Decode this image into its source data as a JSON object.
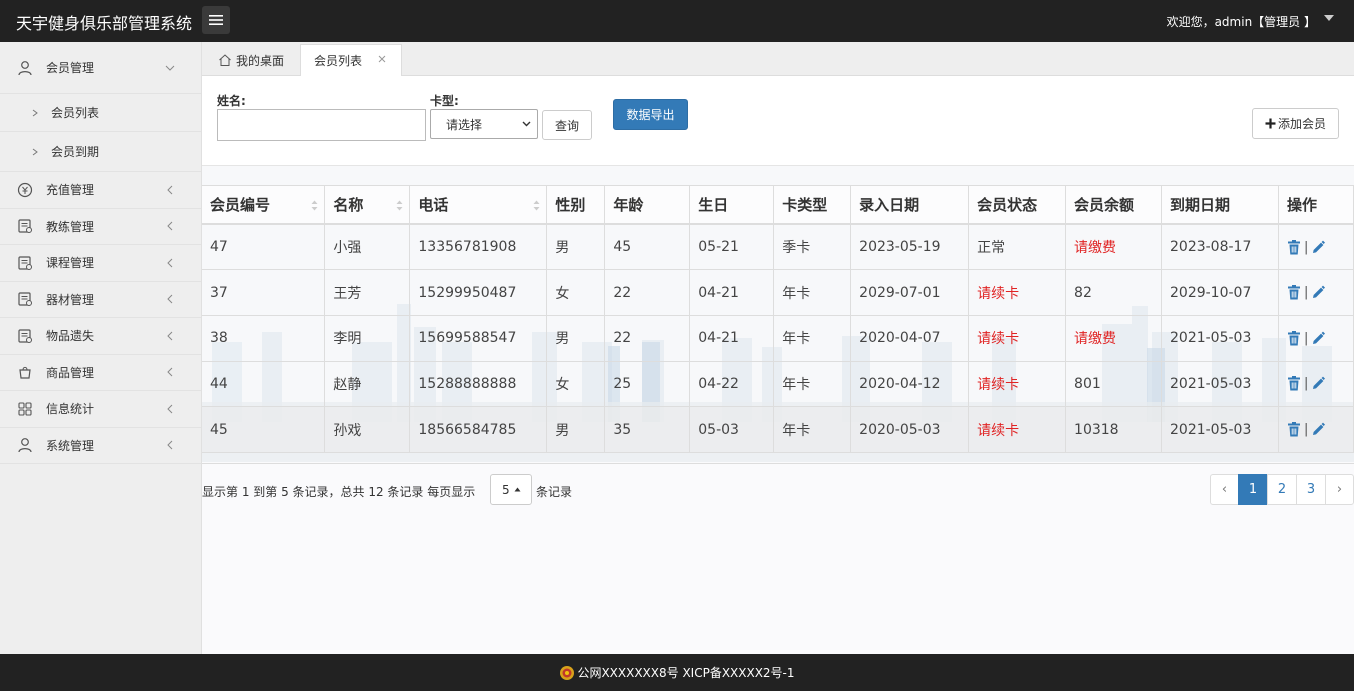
{
  "app": {
    "title": "天宇健身俱乐部管理系统",
    "welcome": "欢迎您，admin【管理员 】"
  },
  "sidebar": {
    "items": [
      {
        "label": "会员管理",
        "icon": "user-icon"
      },
      {
        "label": "充值管理",
        "icon": "money-icon"
      },
      {
        "label": "教练管理",
        "icon": "doc-icon"
      },
      {
        "label": "课程管理",
        "icon": "doc-icon"
      },
      {
        "label": "器材管理",
        "icon": "doc-icon"
      },
      {
        "label": "物品遗失",
        "icon": "doc-icon"
      },
      {
        "label": "商品管理",
        "icon": "bag-icon"
      },
      {
        "label": "信息统计",
        "icon": "grid-icon"
      },
      {
        "label": "系统管理",
        "icon": "user-icon"
      }
    ],
    "subitems": [
      {
        "label": "会员列表"
      },
      {
        "label": "会员到期"
      }
    ]
  },
  "tabs": [
    {
      "label": "我的桌面"
    },
    {
      "label": "会员列表"
    }
  ],
  "search": {
    "name_label": "姓名:",
    "name_value": "",
    "card_label": "卡型:",
    "card_selected": "请选择",
    "query_button": "查询",
    "export_button": "数据导出",
    "add_button": "添加会员"
  },
  "table": {
    "columns": [
      "会员编号",
      "名称",
      "电话",
      "性别",
      "年龄",
      "生日",
      "卡类型",
      "录入日期",
      "会员状态",
      "会员余额",
      "到期日期",
      "操作"
    ],
    "rows": [
      {
        "id": "47",
        "name": "小强",
        "phone": "13356781908",
        "gender": "男",
        "age": "45",
        "birthday": "05-21",
        "card": "季卡",
        "created": "2023-05-19",
        "status": "正常",
        "balance": "请缴费",
        "expire": "2023-08-17",
        "status_red": false,
        "balance_red": true
      },
      {
        "id": "37",
        "name": "王芳",
        "phone": "15299950487",
        "gender": "女",
        "age": "22",
        "birthday": "04-21",
        "card": "年卡",
        "created": "2029-07-01",
        "status": "请续卡",
        "balance": "82",
        "expire": "2029-10-07",
        "status_red": true,
        "balance_red": false
      },
      {
        "id": "38",
        "name": "李明",
        "phone": "15699588547",
        "gender": "男",
        "age": "22",
        "birthday": "04-21",
        "card": "年卡",
        "created": "2020-04-07",
        "status": "请续卡",
        "balance": "请缴费",
        "expire": "2021-05-03",
        "status_red": true,
        "balance_red": true
      },
      {
        "id": "44",
        "name": "赵静",
        "phone": "15288888888",
        "gender": "女",
        "age": "25",
        "birthday": "04-22",
        "card": "年卡",
        "created": "2020-04-12",
        "status": "请续卡",
        "balance": "801",
        "expire": "2021-05-03",
        "status_red": true,
        "balance_red": false
      },
      {
        "id": "45",
        "name": "孙戏",
        "phone": "18566584785",
        "gender": "男",
        "age": "35",
        "birthday": "05-03",
        "card": "年卡",
        "created": "2020-05-03",
        "status": "请续卡",
        "balance": "10318",
        "expire": "2021-05-03",
        "status_red": true,
        "balance_red": false
      }
    ]
  },
  "pagination": {
    "info": "显示第 1 到第 5 条记录，总共 12 条记录 每页显示",
    "page_size": "5",
    "suffix": "条记录",
    "prev": "‹",
    "next": "›",
    "pages": [
      "1",
      "2",
      "3"
    ],
    "current": "1"
  },
  "footer": {
    "text": "公网XXXXXXX8号 XICP备XXXXX2号-1"
  },
  "colors": {
    "header_bg": "#222222",
    "primary": "#337ab7",
    "danger": "#e02424"
  }
}
